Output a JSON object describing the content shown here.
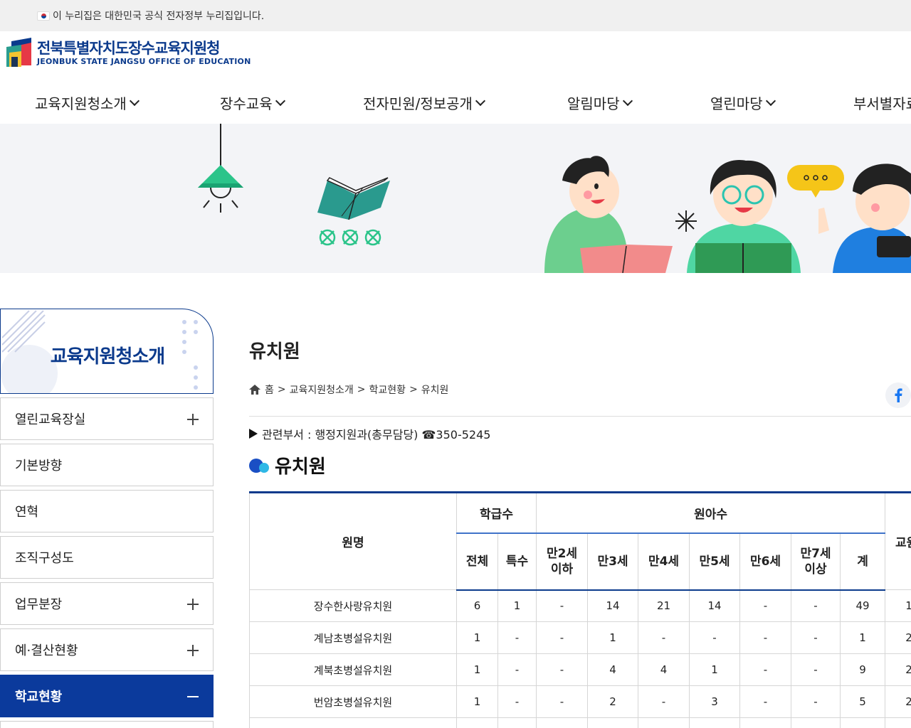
{
  "gov_bar": {
    "text": "이 누리집은 대한민국 공식 전자정부 누리집입니다."
  },
  "logo": {
    "title": "전북특별자치도장수교육지원청",
    "subtitle": "JEONBUK STATE JANGSU OFFICE OF EDUCATION"
  },
  "gnb": [
    {
      "label": "교육지원청소개"
    },
    {
      "label": "장수교육"
    },
    {
      "label": "전자민원/정보공개"
    },
    {
      "label": "알림마당"
    },
    {
      "label": "열린마당"
    },
    {
      "label": "부서별자료"
    }
  ],
  "sidebar": {
    "title": "교육지원청소개",
    "items": [
      {
        "label": "열린교육장실",
        "expandable": true
      },
      {
        "label": "기본방향",
        "expandable": false
      },
      {
        "label": "연혁",
        "expandable": false
      },
      {
        "label": "조직구성도",
        "expandable": false
      },
      {
        "label": "업무분장",
        "expandable": true
      },
      {
        "label": "예·결산현황",
        "expandable": true
      },
      {
        "label": "학교현황",
        "expandable": true,
        "active": true
      }
    ]
  },
  "content": {
    "page_title": "유치원",
    "breadcrumb": [
      "홈",
      "교육지원청소개",
      "학교현황",
      "유치원"
    ],
    "breadcrumb_sep": ">",
    "dept": "관련부서 : 행정지원과(총무담당) ☎350-5245",
    "section_title": "유치원"
  },
  "table": {
    "headers": {
      "name": "원명",
      "class_group": "학급수",
      "children_group": "원아수",
      "staff_partial": "교원",
      "class_cols": [
        "전체",
        "특수"
      ],
      "child_cols": [
        "만2세\n이하",
        "만3세",
        "만4세",
        "만5세",
        "만6세",
        "만7세\n이상",
        "계"
      ]
    },
    "rows": [
      {
        "name": "장수한사랑유치원",
        "cells": [
          "6",
          "1",
          "-",
          "14",
          "21",
          "14",
          "-",
          "-",
          "49",
          "1"
        ]
      },
      {
        "name": "계남초병설유치원",
        "cells": [
          "1",
          "-",
          "-",
          "1",
          "-",
          "-",
          "-",
          "-",
          "1",
          "2"
        ]
      },
      {
        "name": "계북초병설유치원",
        "cells": [
          "1",
          "-",
          "-",
          "4",
          "4",
          "1",
          "-",
          "-",
          "9",
          "2"
        ]
      },
      {
        "name": "번암초병설유치원",
        "cells": [
          "1",
          "-",
          "-",
          "2",
          "-",
          "3",
          "-",
          "-",
          "5",
          "2"
        ]
      },
      {
        "name": "",
        "cells": [
          "",
          "",
          "",
          "",
          "",
          "",
          "",
          "",
          "",
          ""
        ]
      }
    ]
  },
  "colors": {
    "brand_blue": "#0b3a8c",
    "active_blue": "#0b3a9c",
    "banner_bg": "#f3f4f7"
  }
}
